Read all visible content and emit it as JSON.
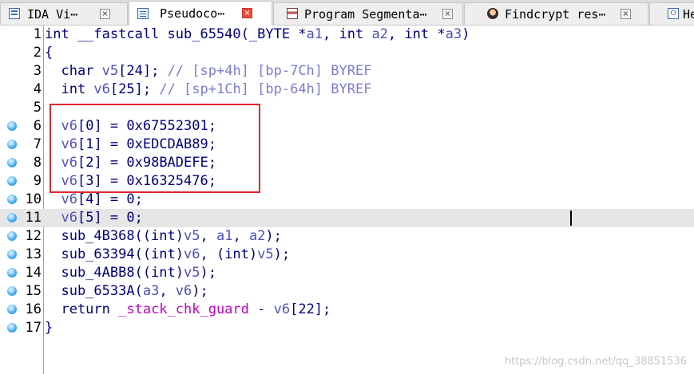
{
  "tabs": [
    {
      "label": "IDA Vi⋯",
      "icon": "ida-view-icon",
      "active": false
    },
    {
      "label": "Pseudoco⋯",
      "icon": "pseudocode-icon",
      "active": true
    },
    {
      "label": "Program Segmenta⋯",
      "icon": "segmentation-icon",
      "active": false
    },
    {
      "label": "Findcrypt res⋯",
      "icon": "findcrypt-icon",
      "active": false
    },
    {
      "label": "He",
      "icon": "hex-view-icon",
      "active": false
    }
  ],
  "tab_close_glyph": "×",
  "hex_icon_glyph": "O",
  "editor": {
    "lines": [
      {
        "num": "1",
        "breakpoint": false,
        "highlighted": false,
        "tokens": [
          [
            "k",
            "int __fastcall sub_65540("
          ],
          [
            "k",
            "_BYTE *"
          ],
          [
            "v",
            "a1"
          ],
          [
            "k",
            ", int "
          ],
          [
            "v",
            "a2"
          ],
          [
            "k",
            ", int *"
          ],
          [
            "v",
            "a3"
          ],
          [
            "k",
            ")"
          ]
        ]
      },
      {
        "num": "2",
        "breakpoint": false,
        "highlighted": false,
        "tokens": [
          [
            "k",
            "{"
          ]
        ]
      },
      {
        "num": "3",
        "breakpoint": false,
        "highlighted": false,
        "tokens": [
          [
            "k",
            "  char "
          ],
          [
            "v",
            "v5"
          ],
          [
            "k",
            "[24]; "
          ],
          [
            "c",
            "// [sp+4h] [bp-7Ch] BYREF"
          ]
        ]
      },
      {
        "num": "4",
        "breakpoint": false,
        "highlighted": false,
        "tokens": [
          [
            "k",
            "  int "
          ],
          [
            "v",
            "v6"
          ],
          [
            "k",
            "[25]; "
          ],
          [
            "c",
            "// [sp+1Ch] [bp-64h] BYREF"
          ]
        ]
      },
      {
        "num": "5",
        "breakpoint": false,
        "highlighted": false,
        "tokens": []
      },
      {
        "num": "6",
        "breakpoint": true,
        "highlighted": false,
        "tokens": [
          [
            "k",
            "  "
          ],
          [
            "v",
            "v6"
          ],
          [
            "k",
            "[0] = 0x67552301;"
          ]
        ]
      },
      {
        "num": "7",
        "breakpoint": true,
        "highlighted": false,
        "tokens": [
          [
            "k",
            "  "
          ],
          [
            "v",
            "v6"
          ],
          [
            "k",
            "[1] = 0xEDCDAB89;"
          ]
        ]
      },
      {
        "num": "8",
        "breakpoint": true,
        "highlighted": false,
        "tokens": [
          [
            "k",
            "  "
          ],
          [
            "v",
            "v6"
          ],
          [
            "k",
            "[2] = 0x98BADEFE;"
          ]
        ]
      },
      {
        "num": "9",
        "breakpoint": true,
        "highlighted": false,
        "tokens": [
          [
            "k",
            "  "
          ],
          [
            "v",
            "v6"
          ],
          [
            "k",
            "[3] = 0x16325476;"
          ]
        ]
      },
      {
        "num": "10",
        "breakpoint": true,
        "highlighted": false,
        "tokens": [
          [
            "k",
            "  "
          ],
          [
            "v",
            "v6"
          ],
          [
            "k",
            "[4] = 0;"
          ]
        ]
      },
      {
        "num": "11",
        "breakpoint": true,
        "highlighted": true,
        "tokens": [
          [
            "k",
            "  "
          ],
          [
            "v",
            "v6"
          ],
          [
            "k",
            "[5] = 0;"
          ]
        ]
      },
      {
        "num": "12",
        "breakpoint": true,
        "highlighted": false,
        "tokens": [
          [
            "k",
            "  sub_4B368((int)"
          ],
          [
            "v",
            "v5"
          ],
          [
            "k",
            ", "
          ],
          [
            "v",
            "a1"
          ],
          [
            "k",
            ", "
          ],
          [
            "v",
            "a2"
          ],
          [
            "k",
            ");"
          ]
        ]
      },
      {
        "num": "13",
        "breakpoint": true,
        "highlighted": false,
        "tokens": [
          [
            "k",
            "  sub_63394((int)"
          ],
          [
            "v",
            "v6"
          ],
          [
            "k",
            ", (int)"
          ],
          [
            "v",
            "v5"
          ],
          [
            "k",
            ");"
          ]
        ]
      },
      {
        "num": "14",
        "breakpoint": true,
        "highlighted": false,
        "tokens": [
          [
            "k",
            "  sub_4ABB8((int)"
          ],
          [
            "v",
            "v5"
          ],
          [
            "k",
            ");"
          ]
        ]
      },
      {
        "num": "15",
        "breakpoint": true,
        "highlighted": false,
        "tokens": [
          [
            "k",
            "  sub_6533A("
          ],
          [
            "v",
            "a3"
          ],
          [
            "k",
            ", "
          ],
          [
            "v",
            "v6"
          ],
          [
            "k",
            ");"
          ]
        ]
      },
      {
        "num": "16",
        "breakpoint": true,
        "highlighted": false,
        "tokens": [
          [
            "k",
            "  return "
          ],
          [
            "i",
            "_stack_chk_guard"
          ],
          [
            "k",
            " - "
          ],
          [
            "v",
            "v6"
          ],
          [
            "k",
            "[22];"
          ]
        ]
      },
      {
        "num": "17",
        "breakpoint": true,
        "highlighted": false,
        "tokens": [
          [
            "k",
            "}"
          ]
        ]
      }
    ]
  },
  "watermark": "https://blog.csdn.net/qq_38851536",
  "colors": {
    "keyword": "#000080",
    "variable": "#4f4fbe",
    "comment": "#7b7bd6",
    "import": "#c200c2",
    "annotation_box": "#e0262f",
    "breakpoint": "#48aef2"
  }
}
